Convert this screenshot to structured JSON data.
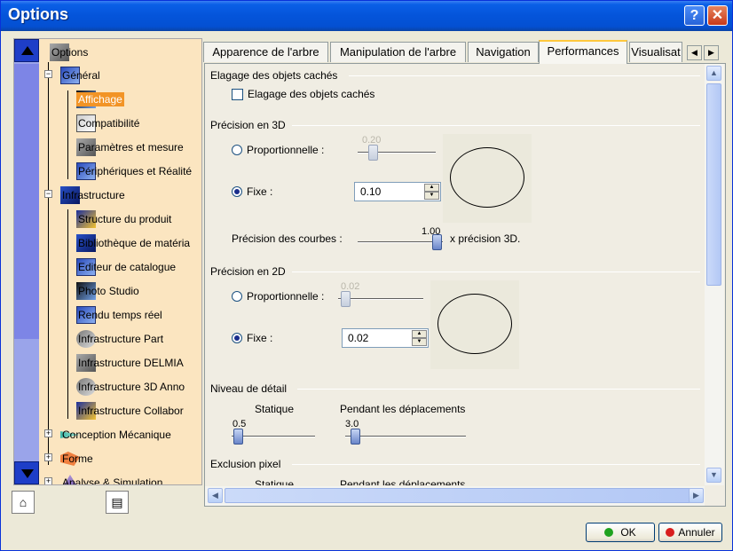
{
  "window": {
    "title": "Options",
    "help_glyph": "?",
    "close_glyph": "✕"
  },
  "tree": {
    "root": "Options",
    "items": [
      {
        "label": "Général",
        "icon": "general-icon"
      },
      {
        "label": "Affichage",
        "icon": "display-icon",
        "selected": true
      },
      {
        "label": "Compatibilité",
        "icon": "compatibility-icon"
      },
      {
        "label": "Paramètres et mesure",
        "icon": "parameters-icon"
      },
      {
        "label": "Périphériques et Réalité",
        "icon": "devices-icon"
      },
      {
        "label": "Infrastructure",
        "icon": "infrastructure-icon"
      },
      {
        "label": "Structure du produit",
        "icon": "product-structure-icon"
      },
      {
        "label": "Bibliothèque de matéria",
        "icon": "material-library-icon"
      },
      {
        "label": "Editeur de catalogue",
        "icon": "catalog-editor-icon"
      },
      {
        "label": "Photo Studio",
        "icon": "photo-studio-icon"
      },
      {
        "label": "Rendu temps réel",
        "icon": "realtime-render-icon"
      },
      {
        "label": "Infrastructure Part",
        "icon": "part-infra-icon"
      },
      {
        "label": "Infrastructure DELMIA",
        "icon": "delmia-icon"
      },
      {
        "label": "Infrastructure 3D Anno",
        "icon": "annotation-icon"
      },
      {
        "label": "Infrastructure Collabor",
        "icon": "collab-icon"
      },
      {
        "label": "Conception Mécanique",
        "icon": "mechanical-icon"
      },
      {
        "label": "Forme",
        "icon": "shape-icon"
      },
      {
        "label": "Analyse & Simulation",
        "icon": "analysis-icon"
      }
    ]
  },
  "tabs": [
    {
      "label": "Apparence de l'arbre"
    },
    {
      "label": "Manipulation de l'arbre"
    },
    {
      "label": "Navigation"
    },
    {
      "label": "Performances",
      "active": true
    },
    {
      "label": "Visualisat"
    }
  ],
  "culling": {
    "title": "Elagage des objets cachés",
    "checkbox_label": "Elagage des objets cachés",
    "checked": false
  },
  "precision3d": {
    "title": "Précision en 3D",
    "proportional_label": "Proportionnelle :",
    "proportional_value": "0.20",
    "fixed_label": "Fixe :",
    "fixed_value": "0.10",
    "mode": "fixed",
    "curves_label": "Précision des courbes :",
    "curves_value": "1.00",
    "curves_suffix": "x précision 3D."
  },
  "precision2d": {
    "title": "Précision en 2D",
    "proportional_label": "Proportionnelle :",
    "proportional_value": "0.02",
    "fixed_label": "Fixe :",
    "fixed_value": "0.02",
    "mode": "fixed"
  },
  "lod": {
    "title": "Niveau de détail",
    "static_label": "Statique",
    "moving_label": "Pendant les déplacements",
    "static_value": "0.5",
    "moving_value": "3.0"
  },
  "pixel": {
    "title": "Exclusion pixel",
    "static_label": "Statique",
    "moving_label": "Pendant les déplacements"
  },
  "buttons": {
    "ok": "OK",
    "cancel": "Annuler"
  },
  "colors": {
    "title_bar": "#0454da",
    "selected": "#f29426",
    "tree_bg": "#fbe5c0",
    "ok_dot": "#1fa21f",
    "cancel_dot": "#d81e1e"
  }
}
